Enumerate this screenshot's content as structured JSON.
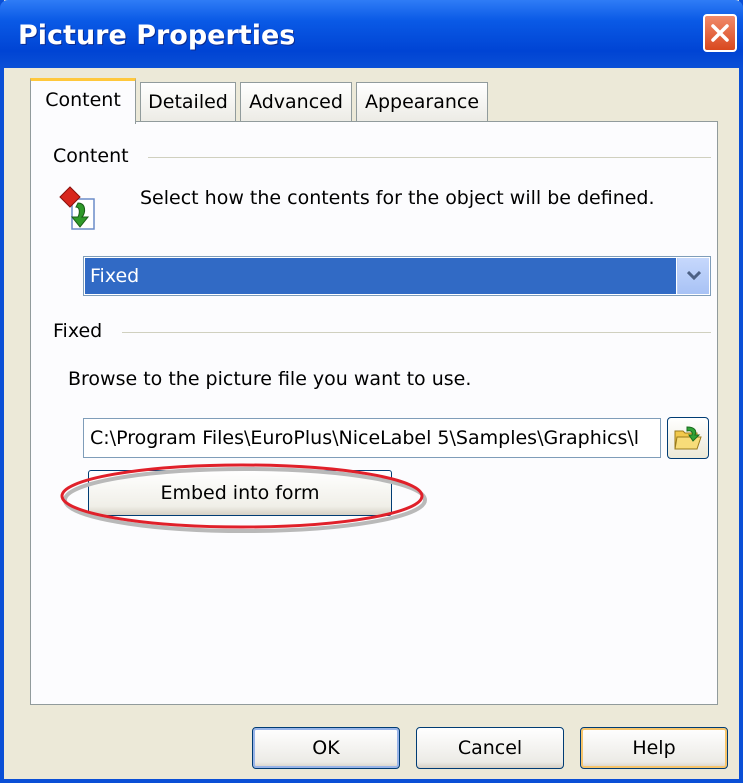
{
  "window": {
    "title": "Picture Properties"
  },
  "tabs": [
    {
      "label": "Content",
      "active": true
    },
    {
      "label": "Detailed",
      "active": false
    },
    {
      "label": "Advanced",
      "active": false
    },
    {
      "label": "Appearance",
      "active": false
    }
  ],
  "content_group": {
    "label": "Content",
    "description": "Select how the contents for the object will be defined.",
    "icon": "content-source-icon",
    "select_value": "Fixed"
  },
  "fixed_group": {
    "label": "Fixed",
    "instruction": "Browse to the picture file you want to use.",
    "path_value": "C:\\Program Files\\EuroPlus\\NiceLabel 5\\Samples\\Graphics\\l",
    "browse_icon": "folder-open-icon",
    "embed_label": "Embed into form"
  },
  "buttons": {
    "ok": "OK",
    "cancel": "Cancel",
    "help": "Help"
  },
  "colors": {
    "titlebar": "#0a4fd6",
    "selection": "#316ac5",
    "annotation": "#e0202a",
    "dialog_bg": "#ece9d8"
  }
}
